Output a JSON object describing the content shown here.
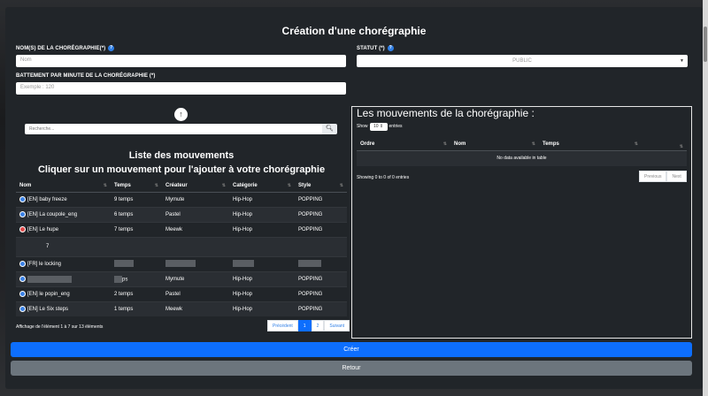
{
  "form": {
    "title": "Création d'une chorégraphie",
    "name_label": "NOM(S) DE LA CHORÉGRAPHIE(*)",
    "name_placeholder": "Nom",
    "status_label": "STATUT (*)",
    "status_value": "PUBLIC",
    "bpm_label": "BATTEMENT PAR MINUTE DE LA CHORÉGRAPHIE (*)",
    "bpm_placeholder": "Exemple : 120",
    "help_icon": "?"
  },
  "left": {
    "search_placeholder": "Recherche...",
    "heading1": "Liste des mouvements",
    "heading2": "Cliquer sur un mouvement pour l'ajouter à votre chorégraphie",
    "columns": [
      "Nom",
      "Temps",
      "Créateur",
      "Catégorie",
      "Style"
    ],
    "rows": [
      {
        "nom": "[EN] baby freeze",
        "temps": "9 temps",
        "createur": "Mymute",
        "categorie": "Hip-Hop",
        "style": "POPPING",
        "dot": "blue"
      },
      {
        "nom": "[EN] La coupole_eng",
        "temps": "6 temps",
        "createur": "Pastel",
        "categorie": "Hip-Hop",
        "style": "POPPING",
        "dot": "blue"
      },
      {
        "nom": "[EN] Le hupe",
        "temps": "7 temps",
        "createur": "Meewk",
        "categorie": "Hip-Hop",
        "style": "POPPING",
        "dot": "red"
      },
      {
        "nom": "7",
        "temps": "",
        "createur": "",
        "categorie": "",
        "style": "",
        "dot": ""
      },
      {
        "nom": "[FR] le locking",
        "temps": "",
        "createur": "",
        "categorie": "",
        "style": "",
        "dot": "blue"
      },
      {
        "nom": "",
        "temps": "ps",
        "createur": "Mymute",
        "categorie": "Hip-Hop",
        "style": "POPPING",
        "dot": "blue"
      },
      {
        "nom": "[EN] le popin_eng",
        "temps": "2 temps",
        "createur": "Pastel",
        "categorie": "Hip-Hop",
        "style": "POPPING",
        "dot": "blue"
      },
      {
        "nom": "[EN] Le Six steps",
        "temps": "1 temps",
        "createur": "Meewk",
        "categorie": "Hip-Hop",
        "style": "POPPING",
        "dot": "blue"
      }
    ],
    "info": "Affichage de l'élément 1 à 7 sur 13 éléments",
    "pager": {
      "prev": "Précédent",
      "p1": "1",
      "p2": "2",
      "next": "Suivant"
    }
  },
  "right": {
    "title": "Les mouvements de la chorégraphie :",
    "show_label": "Show",
    "show_value": "10",
    "entries_label": "entries",
    "columns": [
      "Ordre",
      "Nom",
      "Temps",
      ""
    ],
    "empty": "No data available in table",
    "info": "Showing 0 to 0 of 0 entries",
    "pager": {
      "prev": "Previous",
      "next": "Next"
    }
  },
  "buttons": {
    "create": "Créer",
    "back": "Retour"
  },
  "colors": {
    "primary": "#0d6efd",
    "secondary": "#6c757d",
    "panel": "#212529"
  }
}
